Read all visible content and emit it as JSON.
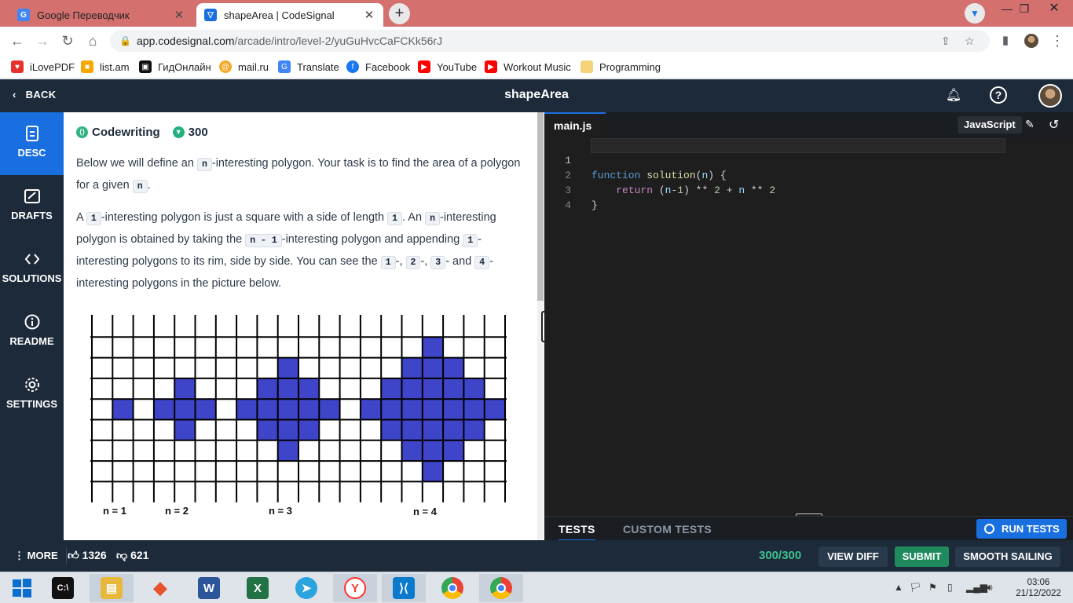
{
  "browser": {
    "tabs": [
      {
        "title": "Google Переводчик",
        "favicon": "google-translate-icon"
      },
      {
        "title": "shapeArea | CodeSignal",
        "favicon": "codesignal-icon"
      }
    ],
    "url_host": "app.codesignal.com",
    "url_path": "/arcade/intro/level-2/yuGuHvcCaFCKk56rJ",
    "bookmarks": [
      "iLovePDF",
      "list.am",
      "ГидОнлайн",
      "mail.ru",
      "Translate",
      "Facebook",
      "YouTube",
      "Workout Music",
      "Programming"
    ]
  },
  "header": {
    "back_label": "BACK",
    "title": "shapeArea"
  },
  "sidebar": {
    "items": [
      {
        "label": "DESC",
        "icon": "document-icon"
      },
      {
        "label": "DRAFTS",
        "icon": "drafts-icon"
      },
      {
        "label": "SOLUTIONS",
        "icon": "code-icon"
      },
      {
        "label": "README",
        "icon": "info-icon"
      },
      {
        "label": "SETTINGS",
        "icon": "gear-icon"
      }
    ]
  },
  "description": {
    "category": "Codewriting",
    "points": "300",
    "p1_a": "Below we will define an ",
    "p1_code1": "n",
    "p1_b": "-interesting polygon. Your task is to find the area of a polygon for a given ",
    "p1_code2": "n",
    "p1_c": ".",
    "p2_a": "A ",
    "p2_c1": "1",
    "p2_b": "-interesting polygon is just a square with a side of length ",
    "p2_c2": "1",
    "p2_c": ". An ",
    "p2_c3": "n",
    "p2_d": "-interesting polygon is obtained by taking the ",
    "p2_c4": "n - 1",
    "p2_e": "-interesting polygon and appending ",
    "p2_c5": "1",
    "p2_f": "-interesting polygons to its rim, side by side. You can see the ",
    "p2_c6": "1",
    "p2_g": "-, ",
    "p2_c7": "2",
    "p2_h": "-, ",
    "p2_c8": "3",
    "p2_i": "- and ",
    "p2_c9": "4",
    "p2_j": "-interesting polygons in the picture below.",
    "figure_labels": [
      "n = 1",
      "n = 2",
      "n = 3",
      "n = 4"
    ],
    "figure_fill": "#3f45c8"
  },
  "editor": {
    "filename": "main.js",
    "language": "JavaScript",
    "line_numbers": [
      "1",
      "2",
      "3",
      "4"
    ],
    "line1": {
      "kw": "function",
      "fn": "solution",
      "open": "(",
      "arg": "n",
      "close": ") {"
    },
    "line2": {
      "kw": "return",
      "t1": " (",
      "v1": "n",
      "t2": "-",
      "n1": "1",
      "t3": ") ** ",
      "n2": "2",
      "t4": " + ",
      "v2": "n",
      "t5": " ** ",
      "n3": "2"
    },
    "line3": "}"
  },
  "tests": {
    "tab_tests": "TESTS",
    "tab_custom": "CUSTOM TESTS",
    "run_label": "RUN TESTS"
  },
  "bottom": {
    "more_label": "MORE",
    "likes": "1326",
    "dislikes": "621",
    "score": "300/300",
    "view_diff": "VIEW DIFF",
    "submit": "SUBMIT",
    "smooth_sailing": "SMOOTH SAILING"
  },
  "taskbar": {
    "time": "03:06",
    "date": "21/12/2022"
  }
}
